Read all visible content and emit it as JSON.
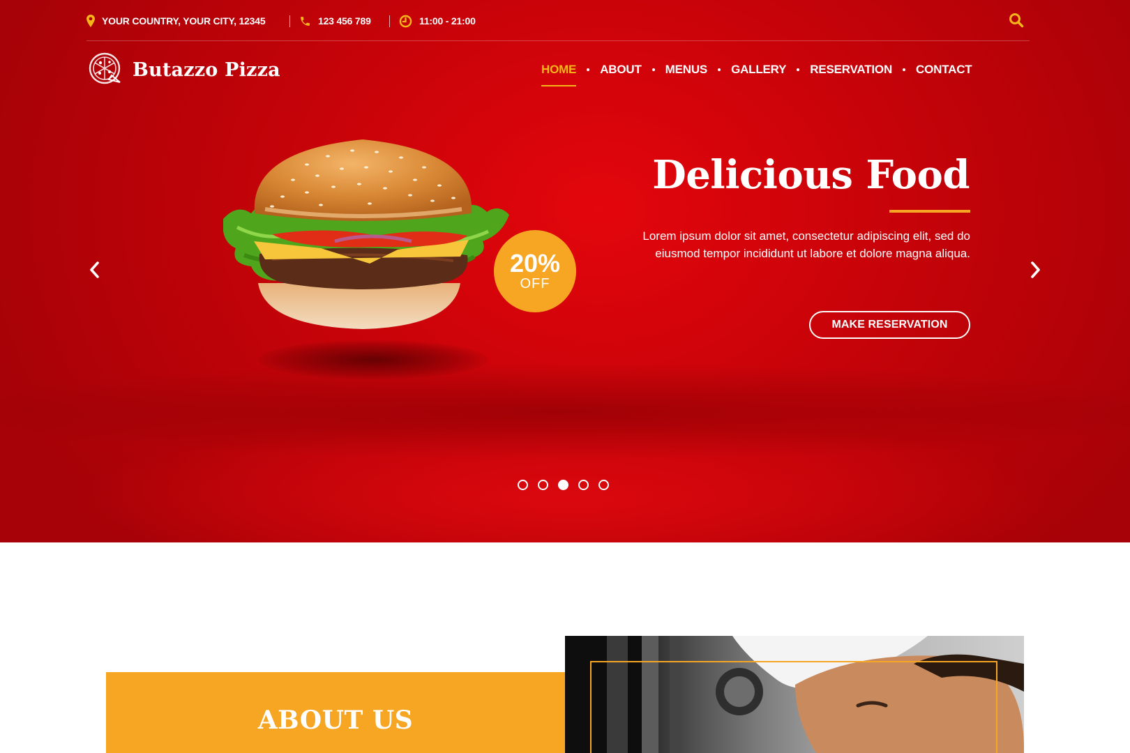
{
  "topbar": {
    "address": "YOUR COUNTRY, YOUR CITY, 12345",
    "phone": "123 456 789",
    "hours": "11:00 - 21:00",
    "address_icon": "map-pin-icon",
    "phone_icon": "phone-icon",
    "hours_icon": "clock-icon",
    "search_icon": "search-icon"
  },
  "brand": {
    "name": "Butazzo Pizza",
    "logo_icon": "pizza-icon"
  },
  "nav": {
    "items": [
      {
        "label": "HOME",
        "active": true
      },
      {
        "label": "ABOUT"
      },
      {
        "label": "MENUS"
      },
      {
        "label": "GALLERY"
      },
      {
        "label": "RESERVATION"
      },
      {
        "label": "CONTACT"
      }
    ]
  },
  "slider": {
    "title": "Delicious Food",
    "text": "Lorem ipsum dolor sit amet, consectetur adipiscing elit, sed do eiusmod tempor incididunt ut labore et dolore magna aliqua.",
    "cta": "MAKE RESERVATION",
    "badge_percent": "20%",
    "badge_off": "OFF",
    "slide_count": 5,
    "active_slide": 3
  },
  "about": {
    "title": "ABOUT US"
  },
  "colors": {
    "primary_red": "#c80309",
    "accent": "#f6a623",
    "nav_active": "#f6b519"
  }
}
